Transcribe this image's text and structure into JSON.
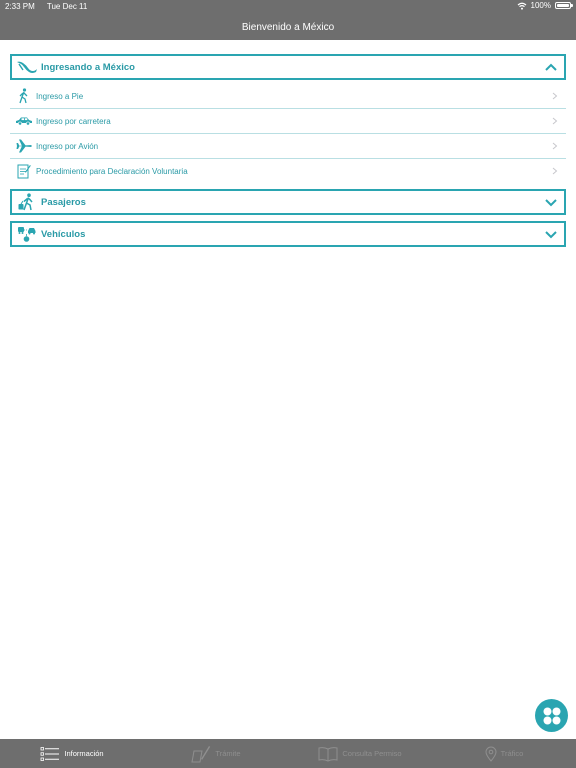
{
  "status": {
    "time": "2:33 PM",
    "date": "Tue Dec 11",
    "battery": "100%"
  },
  "nav": {
    "title": "Bienvenido a México"
  },
  "sections": [
    {
      "title": "Ingresando a México",
      "expanded": true,
      "icon": "mexico-map-icon",
      "items": [
        {
          "label": "Ingreso a Pie",
          "icon": "walking-person-icon"
        },
        {
          "label": "Ingreso por carretera",
          "icon": "car-icon"
        },
        {
          "label": "Ingreso por Avión",
          "icon": "airplane-icon"
        },
        {
          "label": "Procedimiento para Declaración Voluntaria",
          "icon": "document-pencil-icon"
        }
      ]
    },
    {
      "title": "Pasajeros",
      "expanded": false,
      "icon": "traveler-luggage-icon"
    },
    {
      "title": "Vehículos",
      "expanded": false,
      "icon": "vehicles-icon"
    }
  ],
  "tabs": [
    {
      "label": "Información",
      "active": true,
      "icon": "list-icon"
    },
    {
      "label": "Trámite",
      "active": false,
      "icon": "form-pen-icon"
    },
    {
      "label": "Consulta Permiso",
      "active": false,
      "icon": "book-icon"
    },
    {
      "label": "Tráfico",
      "active": false,
      "icon": "location-pin-icon"
    }
  ],
  "colors": {
    "accent": "#2aa5b1",
    "bar": "#6e6e6e",
    "divider": "#b9dfe3",
    "inactive_tab": "#8f8f8f"
  }
}
